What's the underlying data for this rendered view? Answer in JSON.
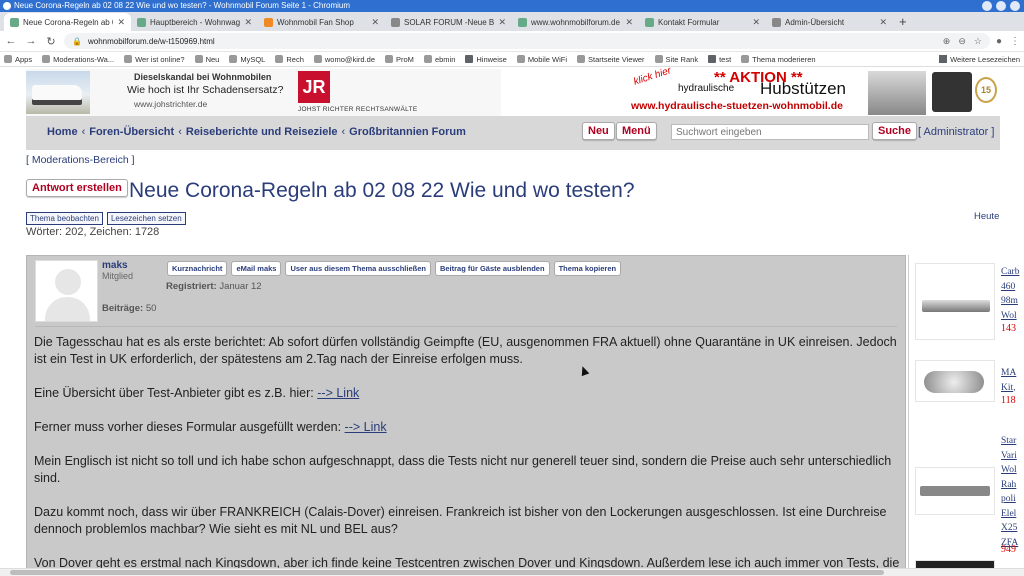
{
  "window": {
    "title": "Neue Corona-Regeln ab 02 08 22 Wie und wo testen? - Wohnmobil Forum Seite 1 - Chromium"
  },
  "tabs": [
    {
      "label": "Neue Corona-Regeln ab 02 08 22 Wie und wo testen?"
    },
    {
      "label": "Hauptbereich - Wohnwagen"
    },
    {
      "label": "Wohnmobil Fan Shop"
    },
    {
      "label": "SOLAR FORUM -Neue Beiträge"
    },
    {
      "label": "www.wohnmobilforum.de / FAQ"
    },
    {
      "label": "Kontakt Formular"
    },
    {
      "label": "Admin-Übersicht"
    }
  ],
  "address": {
    "url": "wohnmobilforum.de/w-t150969.html"
  },
  "bookmarks": {
    "items": [
      "Apps",
      "Moderations-Wa...",
      "Wer ist online?",
      "Neu",
      "MySQL",
      "Rech",
      "womo@kird.de",
      "ProM",
      "ebmin",
      "Hinweise",
      "Mobile WiFi",
      "Startseite Viewer",
      "Site Rank",
      "test",
      "Thema moderieren"
    ],
    "other": "Weitere Lesezeichen"
  },
  "banner": {
    "left_line1": "Dieselskandal bei Wohnmobilen",
    "left_line2": "Wie hoch ist Ihr Schadensersatz?",
    "left_line3": "www.johstrichter.de",
    "logo_text": "JR",
    "logo_caption": "JOHST RICHTER RECHTSANWÄLTE",
    "right_klick": "klick hier",
    "right_aktion": "** AKTION **",
    "right_hydr": "hydraulische",
    "right_hub": "Hubstützen",
    "right_url": "www.hydraulische-stuetzen-wohnmobil.de",
    "seal": "15"
  },
  "nav": {
    "crumbs": [
      "Home",
      "Foren-Übersicht",
      "Reiseberichte und Reiseziele",
      "Großbritannien Forum"
    ],
    "sep": "‹",
    "new_label": "Neu",
    "menu_label": "Menü",
    "search_placeholder": "Suchwort eingeben",
    "search_button": "Suche",
    "admin_link": "[ Administrator ]"
  },
  "topic": {
    "mod_link": "[ Moderations-Bereich ]",
    "reply_button": "Antwort erstellen",
    "title": "Neue Corona-Regeln ab 02 08 22 Wie und wo testen?",
    "watch_button": "Thema beobachten",
    "bookmark_button": "Lesezeichen setzen",
    "date": "Heute",
    "stats": "Wörter: 202, Zeichen: 1728"
  },
  "post": {
    "username": "maks",
    "role": "Mitglied",
    "actions": [
      "Kurznachricht",
      "eMail maks",
      "User aus diesem Thema ausschließen",
      "Beitrag für Gäste ausblenden",
      "Thema kopieren"
    ],
    "registered_label": "Registriert:",
    "registered_value": "Januar 12",
    "posts_label": "Beiträge:",
    "posts_value": "50",
    "p1": "Die Tagesschau hat es als erste berichtet: Ab sofort dürfen vollständig Geimpfte (EU, ausgenommen FRA aktuell) ohne Quarantäne in UK einreisen. Jedoch ist ein Test in UK erforderlich, der spätestens am 2.Tag nach der Einreise erfolgen muss.",
    "p2_text": "Eine Übersicht über Test-Anbieter gibt es z.B. hier: ",
    "p2_link": "--> Link",
    "p3_text": "Ferner muss vorher dieses Formular ausgefüllt werden: ",
    "p3_link": "--> Link",
    "p4": "Mein Englisch ist nicht so toll und ich habe schon aufgeschnappt, dass die Tests nicht nur generell teuer sind, sondern die Preise auch sehr unterschiedlich sind.",
    "p5": "Dazu kommt noch, dass wir über FRANKREICH (Calais-Dover) einreisen. Frankreich ist bisher von den Lockerungen ausgeschlossen. Ist eine Durchreise dennoch problemlos machbar? Wie sieht es mit NL und BEL aus?",
    "p6": "Von Dover geht es erstmal nach Kingsdown, aber ich finde keine Testcentren zwischen Dover und Kingsdown. Außerdem lese ich auch immer von Tests, die"
  },
  "sidebar_ads": [
    {
      "title": "Carb 460 98m Wol",
      "price": "143"
    },
    {
      "title": "MA Kit,",
      "price": "118"
    },
    {
      "title": "Star Vari Wol Rah poli Elel X25 ZFA",
      "price": "949"
    }
  ]
}
